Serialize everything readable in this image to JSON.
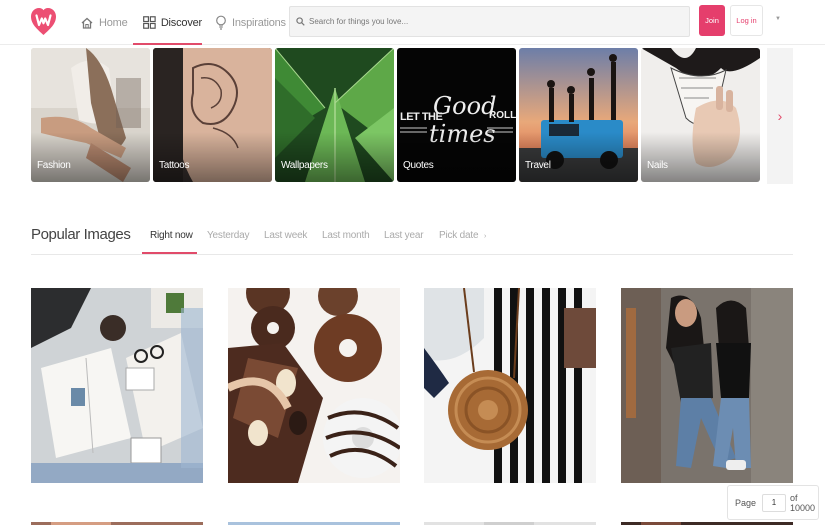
{
  "header": {
    "nav": {
      "home": "Home",
      "discover": "Discover",
      "inspirations": "Inspirations"
    },
    "search_placeholder": "Search for things you love...",
    "join_label": "Join",
    "login_label": "Log in",
    "more_caret": "▼"
  },
  "categories": [
    {
      "label": "Fashion"
    },
    {
      "label": "Tattoos"
    },
    {
      "label": "Wallpapers"
    },
    {
      "label": "Quotes"
    },
    {
      "label": "Travel"
    },
    {
      "label": "Nails"
    }
  ],
  "category_next_glyph": "›",
  "quote_card_words": [
    "LET THE",
    "Good",
    "ROLL",
    "times"
  ],
  "popular": {
    "title": "Popular Images",
    "tabs": [
      "Right now",
      "Yesterday",
      "Last week",
      "Last month",
      "Last year",
      "Pick date"
    ],
    "pick_date_caret": "›",
    "active_tab": "Right now"
  },
  "pager": {
    "page_label": "Page",
    "current": "1",
    "of_label": "of 10000"
  },
  "colors": {
    "accent": "#e14b6a",
    "join_bg": "#e53e6c"
  }
}
